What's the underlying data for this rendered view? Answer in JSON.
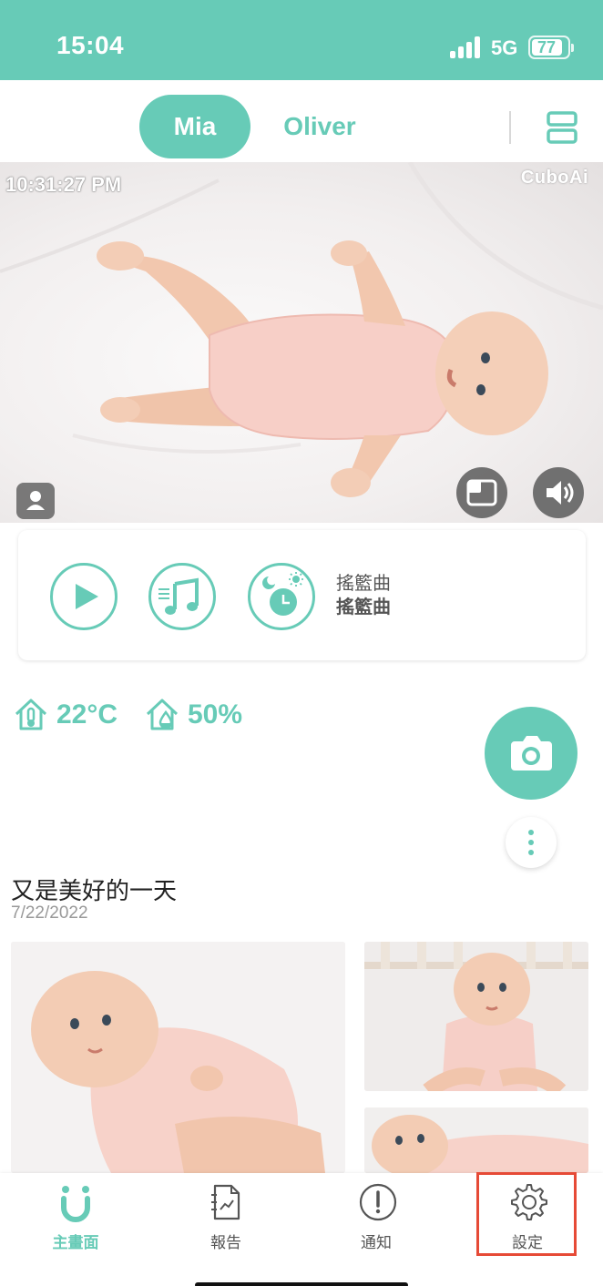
{
  "status_bar": {
    "time": "15:04",
    "network": "5G",
    "battery": "77",
    "battery_level": 0.77
  },
  "header": {
    "tabs": [
      {
        "label": "Mia",
        "active": true
      },
      {
        "label": "Oliver",
        "active": false
      }
    ],
    "layout_icon": "split-view-icon"
  },
  "camera": {
    "timestamp": "10:31:27 PM",
    "brand": "CuboAi"
  },
  "lullaby": {
    "line1": "搖籃曲",
    "line2": "搖籃曲"
  },
  "environment": {
    "temperature": "22°C",
    "humidity": "50%"
  },
  "day": {
    "title": "又是美好的一天",
    "date": "7/22/2022"
  },
  "nav": {
    "items": [
      {
        "label": "主畫面",
        "icon": "cuboai-home-icon",
        "active": true
      },
      {
        "label": "報告",
        "icon": "report-icon",
        "active": false
      },
      {
        "label": "通知",
        "icon": "alert-icon",
        "active": false
      },
      {
        "label": "設定",
        "icon": "gear-icon",
        "active": false
      }
    ]
  },
  "colors": {
    "accent": "#67CBB7",
    "highlight": "#E64A36"
  }
}
